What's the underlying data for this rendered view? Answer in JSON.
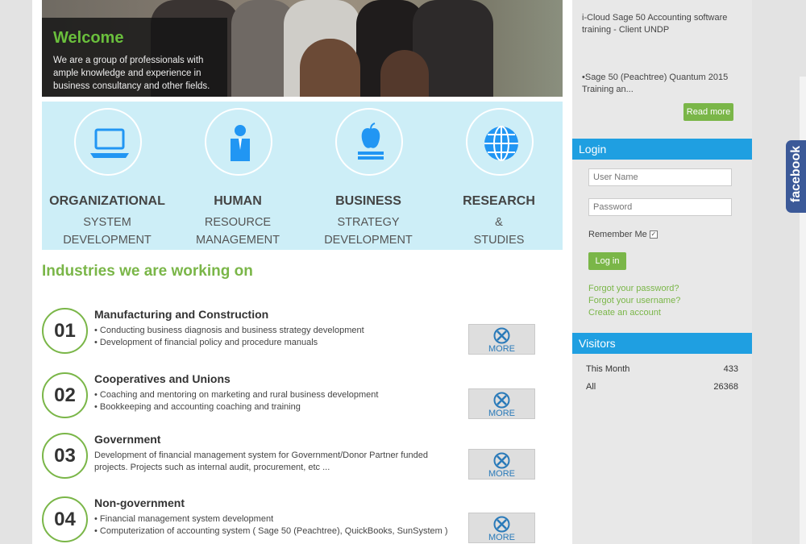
{
  "hero": {
    "title": "Welcome",
    "lines": [
      "We are a group of professionals with",
      "ample knowledge and experience in",
      "business consultancy and other fields."
    ]
  },
  "services": [
    {
      "icon": "laptop-icon",
      "line1": "ORGANIZATIONAL",
      "line2": "SYSTEM",
      "line3": "DEVELOPMENT"
    },
    {
      "icon": "person-icon",
      "line1": "HUMAN",
      "line2": "RESOURCE",
      "line3": "MANAGEMENT"
    },
    {
      "icon": "apple-book-icon",
      "line1": "BUSINESS",
      "line2": "STRATEGY",
      "line3": "DEVELOPMENT"
    },
    {
      "icon": "globe-icon",
      "line1": "RESEARCH",
      "line2": "&",
      "line3": "STUDIES"
    }
  ],
  "industries": {
    "title": "Industries we are working on",
    "more_label": "MORE",
    "items": [
      {
        "num": "01",
        "name": "Manufacturing and Construction",
        "l1": "• Conducting business diagnosis and business strategy development",
        "l2": "• Development of financial policy and procedure manuals"
      },
      {
        "num": "02",
        "name": "Cooperatives and Unions",
        "l1": "• Coaching and mentoring on marketing and rural business development",
        "l2": "• Bookkeeping and accounting coaching and training"
      },
      {
        "num": "03",
        "name": "Government",
        "l1": "Development of financial management system for Government/Donor Partner funded",
        "l2": "projects. Projects such as internal audit, procurement, etc ..."
      },
      {
        "num": "04",
        "name": "Non-government",
        "l1": "• Financial management system development",
        "l2": "• Computerization of accounting system ( Sage 50 (Peachtree), QuickBooks, SunSystem )"
      }
    ]
  },
  "sidebar": {
    "news1": [
      "i-Cloud Sage 50 Accounting software",
      "training - Client UNDP"
    ],
    "news2": [
      "•Sage 50 (Peachtree) Quantum 2015",
      "Training an..."
    ],
    "read_more": "Read more",
    "login": {
      "title": "Login",
      "username_placeholder": "User Name",
      "password_placeholder": "Password",
      "remember": "Remember Me",
      "button": "Log in",
      "forgot_password": "Forgot your password?",
      "forgot_username": "Forgot your username?",
      "create_account": "Create an account"
    },
    "visitors": {
      "title": "Visitors",
      "rows": [
        {
          "label": "This Month",
          "value": "433"
        },
        {
          "label": "All",
          "value": "26368"
        }
      ]
    }
  },
  "facebook": "facebook",
  "colors": {
    "accent_green": "#7ab648",
    "accent_blue": "#1f9fe1",
    "services_bg": "#cdeef7",
    "facebook_blue": "#3b5998"
  }
}
